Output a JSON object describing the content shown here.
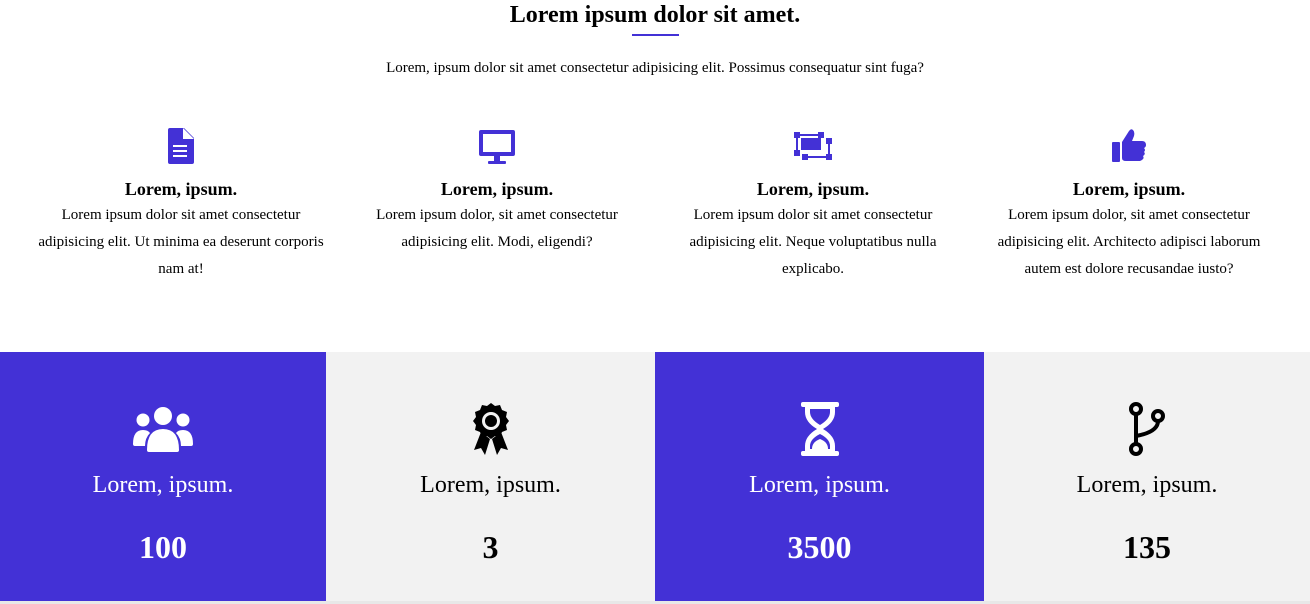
{
  "header": {
    "title": "Lorem ipsum dolor sit amet.",
    "subtitle": "Lorem, ipsum dolor sit amet consectetur adipisicing elit. Possimus consequatur sint fuga?"
  },
  "colors": {
    "accent": "#4331d6",
    "light_panel": "#f2f2f2"
  },
  "features": [
    {
      "icon": "file-document-icon",
      "title": "Lorem, ipsum.",
      "description": "Lorem ipsum dolor sit amet consectetur adipisicing elit. Ut minima ea deserunt corporis nam at!"
    },
    {
      "icon": "desktop-monitor-icon",
      "title": "Lorem, ipsum.",
      "description": "Lorem ipsum dolor, sit amet consectetur adipisicing elit. Modi, eligendi?"
    },
    {
      "icon": "object-group-icon",
      "title": "Lorem, ipsum.",
      "description": "Lorem ipsum dolor sit amet consectetur adipisicing elit. Neque voluptatibus nulla explicabo."
    },
    {
      "icon": "thumbs-up-icon",
      "title": "Lorem, ipsum.",
      "description": "Lorem ipsum dolor, sit amet consectetur adipisicing elit. Architecto adipisci laborum autem est dolore recusandae iusto?"
    }
  ],
  "stats": [
    {
      "icon": "users-icon",
      "label": "Lorem, ipsum.",
      "value": "100",
      "theme": "dark"
    },
    {
      "icon": "award-ribbon-icon",
      "label": "Lorem, ipsum.",
      "value": "3",
      "theme": "light"
    },
    {
      "icon": "hourglass-icon",
      "label": "Lorem, ipsum.",
      "value": "3500",
      "theme": "dark"
    },
    {
      "icon": "code-branch-icon",
      "label": "Lorem, ipsum.",
      "value": "135",
      "theme": "light"
    }
  ]
}
